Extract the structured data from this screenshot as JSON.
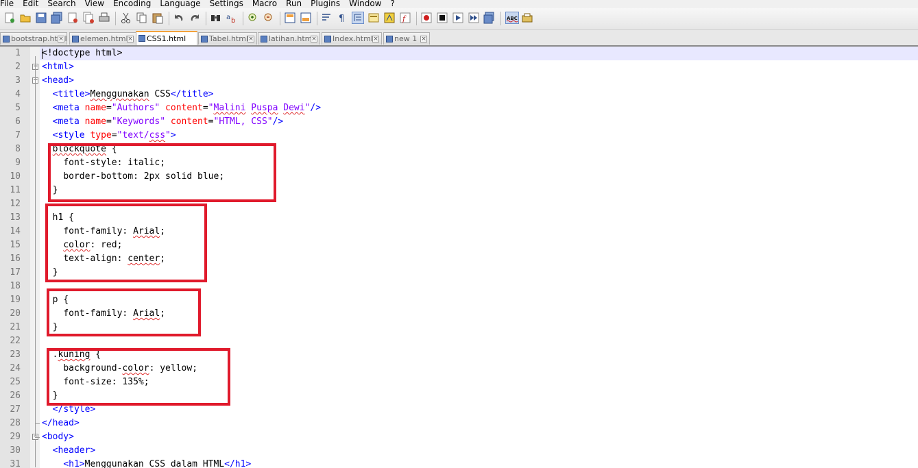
{
  "menu": [
    "File",
    "Edit",
    "Search",
    "View",
    "Encoding",
    "Language",
    "Settings",
    "Macro",
    "Run",
    "Plugins",
    "Window",
    "?"
  ],
  "tabs": [
    {
      "label": "bootstrap.html",
      "active": false
    },
    {
      "label": "elemen.html",
      "active": false
    },
    {
      "label": "CSS1.html",
      "active": true
    },
    {
      "label": "Tabel.html",
      "active": false
    },
    {
      "label": "latihan.html",
      "active": false
    },
    {
      "label": "Index.html",
      "active": false
    },
    {
      "label": "new  1",
      "active": false
    }
  ],
  "close_glyph": "×",
  "code_lines": [
    {
      "n": "1",
      "segs": [
        [
          "t",
          "<!doctype html>"
        ]
      ]
    },
    {
      "n": "2",
      "segs": [
        [
          "g",
          "<html>"
        ]
      ]
    },
    {
      "n": "3",
      "segs": [
        [
          "g",
          "<head>"
        ]
      ]
    },
    {
      "n": "4",
      "segs": [
        [
          "t",
          "  "
        ],
        [
          "g",
          "<title>"
        ],
        [
          "t",
          "Menggunakan CSS"
        ],
        [
          "g",
          "</title>"
        ]
      ]
    },
    {
      "n": "5",
      "segs": [
        [
          "t",
          "  "
        ],
        [
          "g",
          "<meta "
        ],
        [
          "a",
          "name"
        ],
        [
          "t",
          "="
        ],
        [
          "v",
          "\"Authors\""
        ],
        [
          "t",
          " "
        ],
        [
          "a",
          "content"
        ],
        [
          "t",
          "="
        ],
        [
          "v",
          "\"Malini Puspa Dewi\""
        ],
        [
          "g",
          "/>"
        ]
      ]
    },
    {
      "n": "6",
      "segs": [
        [
          "t",
          "  "
        ],
        [
          "g",
          "<meta "
        ],
        [
          "a",
          "name"
        ],
        [
          "t",
          "="
        ],
        [
          "v",
          "\"Keywords\""
        ],
        [
          "t",
          " "
        ],
        [
          "a",
          "content"
        ],
        [
          "t",
          "="
        ],
        [
          "v",
          "\"HTML, CSS\""
        ],
        [
          "g",
          "/>"
        ]
      ]
    },
    {
      "n": "7",
      "segs": [
        [
          "t",
          "  "
        ],
        [
          "g",
          "<style "
        ],
        [
          "a",
          "type"
        ],
        [
          "t",
          "="
        ],
        [
          "v",
          "\"text/css\""
        ],
        [
          "g",
          ">"
        ]
      ]
    },
    {
      "n": "8",
      "segs": [
        [
          "t",
          "  blockquote {"
        ]
      ]
    },
    {
      "n": "9",
      "segs": [
        [
          "t",
          "    font-style: italic;"
        ]
      ]
    },
    {
      "n": "10",
      "segs": [
        [
          "t",
          "    border-bottom: 2px solid blue;"
        ]
      ]
    },
    {
      "n": "11",
      "segs": [
        [
          "t",
          "  }"
        ]
      ]
    },
    {
      "n": "12",
      "segs": []
    },
    {
      "n": "13",
      "segs": [
        [
          "t",
          "  h1 {"
        ]
      ]
    },
    {
      "n": "14",
      "segs": [
        [
          "t",
          "    font-family: Arial;"
        ]
      ]
    },
    {
      "n": "15",
      "segs": [
        [
          "t",
          "    color: red;"
        ]
      ]
    },
    {
      "n": "16",
      "segs": [
        [
          "t",
          "    text-align: center;"
        ]
      ]
    },
    {
      "n": "17",
      "segs": [
        [
          "t",
          "  }"
        ]
      ]
    },
    {
      "n": "18",
      "segs": []
    },
    {
      "n": "19",
      "segs": [
        [
          "t",
          "  p {"
        ]
      ]
    },
    {
      "n": "20",
      "segs": [
        [
          "t",
          "    font-family: Arial;"
        ]
      ]
    },
    {
      "n": "21",
      "segs": [
        [
          "t",
          "  }"
        ]
      ]
    },
    {
      "n": "22",
      "segs": []
    },
    {
      "n": "23",
      "segs": [
        [
          "t",
          "  .kuning {"
        ]
      ]
    },
    {
      "n": "24",
      "segs": [
        [
          "t",
          "    background-color: yellow;"
        ]
      ]
    },
    {
      "n": "25",
      "segs": [
        [
          "t",
          "    font-size: 135%;"
        ]
      ]
    },
    {
      "n": "26",
      "segs": [
        [
          "t",
          "  }"
        ]
      ]
    },
    {
      "n": "27",
      "segs": [
        [
          "t",
          "  "
        ],
        [
          "g",
          "</style>"
        ]
      ]
    },
    {
      "n": "28",
      "segs": [
        [
          "g",
          "</head>"
        ]
      ]
    },
    {
      "n": "29",
      "segs": [
        [
          "g",
          "<body>"
        ]
      ]
    },
    {
      "n": "30",
      "segs": [
        [
          "t",
          "  "
        ],
        [
          "g",
          "<header>"
        ]
      ]
    },
    {
      "n": "31",
      "segs": [
        [
          "t",
          "    "
        ],
        [
          "g",
          "<h1>"
        ],
        [
          "t",
          "Menggunakan CSS dalam HTML"
        ],
        [
          "g",
          "</h1>"
        ]
      ]
    }
  ],
  "colors": {
    "tag": "#0000ff",
    "attribute": "#ff0000",
    "value": "#8000ff",
    "highlight_box": "#e01a2c",
    "current_line": "#e8e8ff",
    "active_tab_accent": "#f3a23b"
  }
}
